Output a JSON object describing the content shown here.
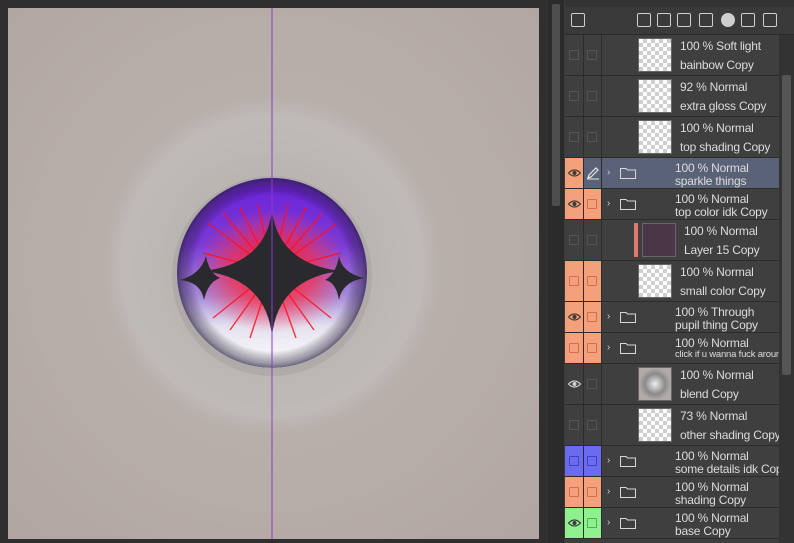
{
  "layers": [
    {
      "name": "bainbow Copy",
      "opacity_mode": "100 % Soft light",
      "kind": "raster",
      "visible": false
    },
    {
      "name": "extra gloss Copy",
      "opacity_mode": "92 % Normal",
      "kind": "raster",
      "visible": false
    },
    {
      "name": "top shading Copy",
      "opacity_mode": "100 % Normal",
      "kind": "raster",
      "visible": false
    },
    {
      "name": "sparkle things",
      "opacity_mode": "100 % Normal",
      "kind": "folder",
      "visible": true,
      "selected": true,
      "color": "#f4a07a"
    },
    {
      "name": "top color idk Copy",
      "opacity_mode": "100 % Normal",
      "kind": "folder",
      "visible": true,
      "color": "#f4a07a"
    },
    {
      "name": "Layer 15 Copy",
      "opacity_mode": "100 % Normal",
      "kind": "raster",
      "visible": false
    },
    {
      "name": "small color Copy",
      "opacity_mode": "100 % Normal",
      "kind": "raster",
      "visible": false,
      "color": "#f4a07a"
    },
    {
      "name": "pupil thing Copy",
      "opacity_mode": "100 % Through",
      "kind": "folder",
      "visible": true,
      "color": "#f4a07a"
    },
    {
      "name": "click if u wanna fuck around",
      "opacity_mode": "100 % Normal",
      "kind": "folder",
      "visible": false,
      "color": "#f4a07a"
    },
    {
      "name": "blend Copy",
      "opacity_mode": "100 % Normal",
      "kind": "raster",
      "visible": true
    },
    {
      "name": "other shading Copy",
      "opacity_mode": "73 % Normal",
      "kind": "raster",
      "visible": false
    },
    {
      "name": "some details idk Copy",
      "opacity_mode": "100 % Normal",
      "kind": "folder",
      "visible": false,
      "color": "#6b6bf0"
    },
    {
      "name": "shading Copy",
      "opacity_mode": "100 % Normal",
      "kind": "folder",
      "visible": false,
      "color": "#f4a07a"
    },
    {
      "name": "base Copy",
      "opacity_mode": "100 % Normal",
      "kind": "folder",
      "visible": true,
      "color": "#8ef08e"
    }
  ],
  "toolbar_icons": [
    "new-raster-layer-icon",
    "new-vector-layer-icon",
    "new-layer-folder-icon",
    "copy-layer-icon",
    "merge-layer-icon",
    "layer-mask-icon",
    "apply-mask-icon",
    "delete-layer-icon"
  ],
  "canvas": {
    "background": "#b6aaa6",
    "iris_color": "#6b2fd0",
    "highlight_color": "#ff2030"
  }
}
